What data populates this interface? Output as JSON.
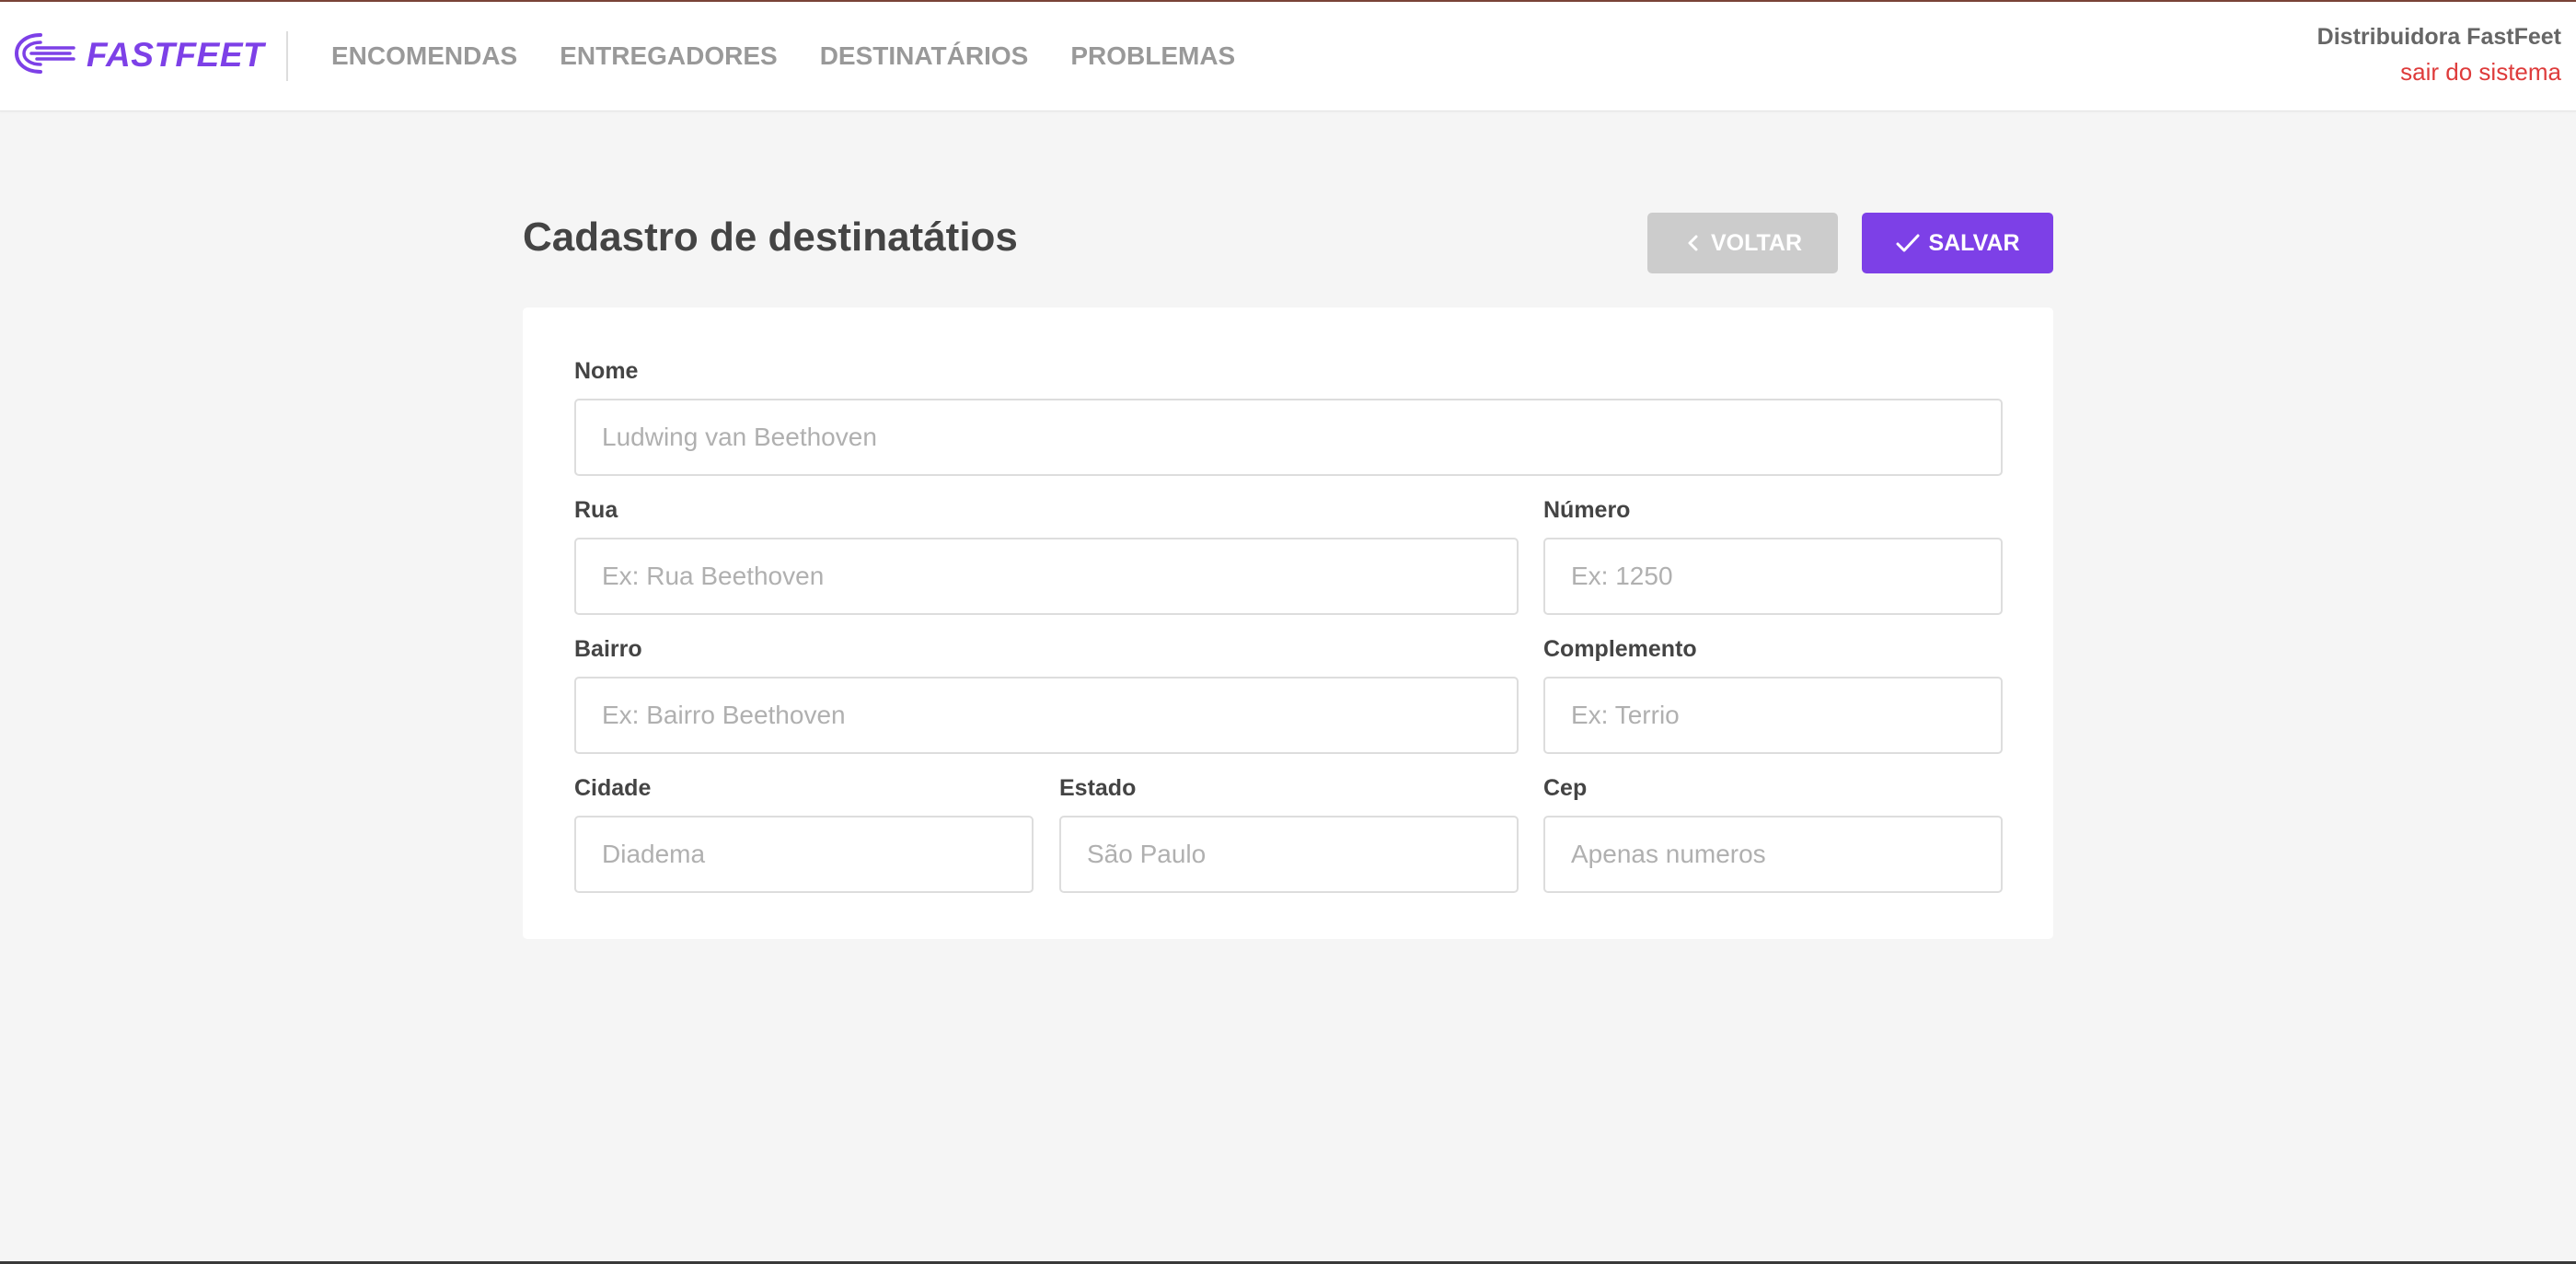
{
  "header": {
    "logo_text": "FASTFEET",
    "nav": [
      {
        "label": "ENCOMENDAS"
      },
      {
        "label": "ENTREGADORES"
      },
      {
        "label": "DESTINATÁRIOS"
      },
      {
        "label": "PROBLEMAS"
      }
    ],
    "user_name": "Distribuidora FastFeet",
    "logout_label": "sair do sistema"
  },
  "page": {
    "title": "Cadastro de destinatátios",
    "back_label": "VOLTAR",
    "save_label": "SALVAR"
  },
  "form": {
    "nome": {
      "label": "Nome",
      "placeholder": "Ludwing van Beethoven",
      "value": ""
    },
    "rua": {
      "label": "Rua",
      "placeholder": "Ex: Rua Beethoven",
      "value": ""
    },
    "numero": {
      "label": "Número",
      "placeholder": "Ex: 1250",
      "value": ""
    },
    "bairro": {
      "label": "Bairro",
      "placeholder": "Ex: Bairro Beethoven",
      "value": ""
    },
    "complemento": {
      "label": "Complemento",
      "placeholder": "Ex: Terrio",
      "value": ""
    },
    "cidade": {
      "label": "Cidade",
      "placeholder": "Diadema",
      "value": ""
    },
    "estado": {
      "label": "Estado",
      "placeholder": "São Paulo",
      "value": ""
    },
    "cep": {
      "label": "Cep",
      "placeholder": "Apenas numeros",
      "value": ""
    }
  },
  "colors": {
    "accent": "#7d40e7",
    "logout": "#de3b3b",
    "back_button": "#cccccc",
    "background": "#f5f5f5"
  },
  "icons": [
    "fastfeet-logo-icon",
    "chevron-left-icon",
    "check-icon"
  ]
}
